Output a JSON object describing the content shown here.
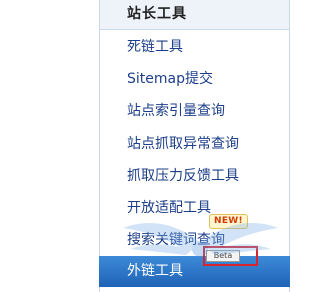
{
  "panel": {
    "title": "站长工具"
  },
  "menu": {
    "items": [
      {
        "label": "死链工具"
      },
      {
        "label": "Sitemap提交"
      },
      {
        "label": "站点索引量查询"
      },
      {
        "label": "站点抓取异常查询"
      },
      {
        "label": "抓取压力反馈工具"
      },
      {
        "label": "开放适配工具"
      },
      {
        "label": "搜索关键词查询"
      },
      {
        "label": "外链工具"
      }
    ],
    "active_index": 7
  },
  "badges": {
    "new": "NEW!",
    "beta": "Beta"
  },
  "colors": {
    "link": "#1d3f8a",
    "header_bg": "#eef3fa",
    "active_bg": "#2d74c6",
    "highlight_box": "#d8242a"
  }
}
